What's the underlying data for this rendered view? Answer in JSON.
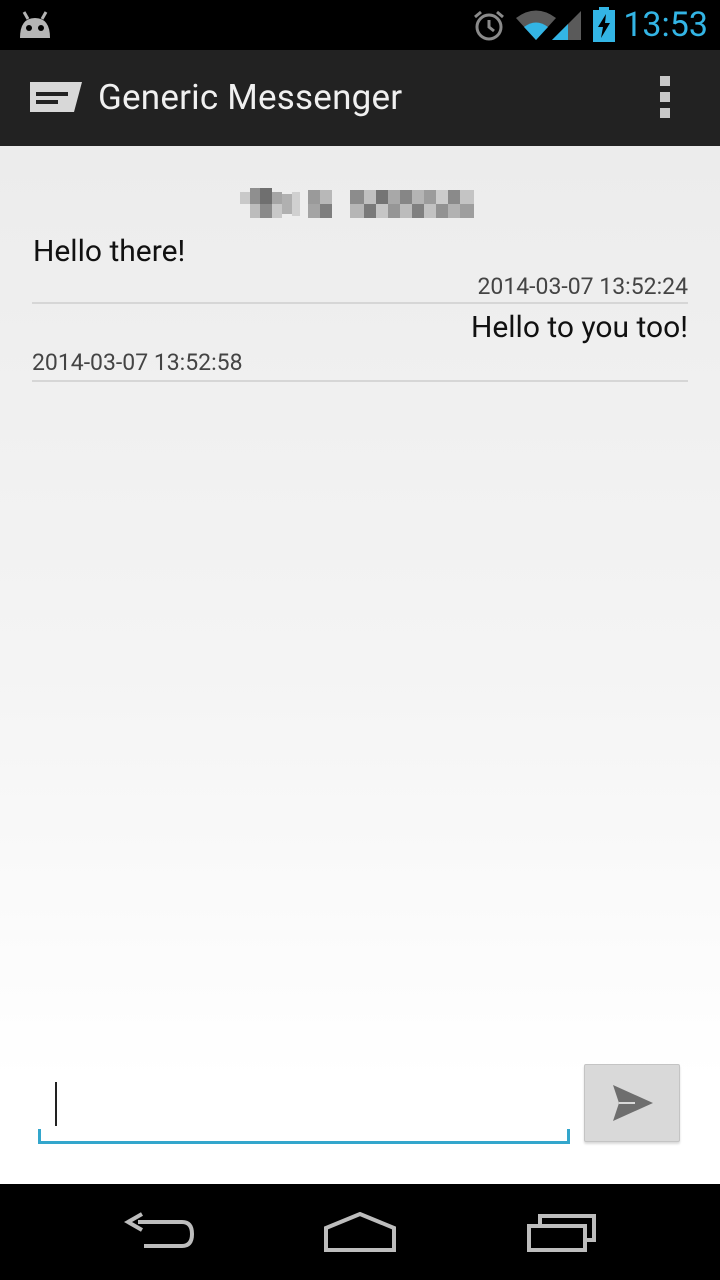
{
  "status_bar": {
    "time": "13:53",
    "icons": [
      "android-icon",
      "alarm-icon",
      "wifi-icon",
      "signal-icon",
      "battery-charging-icon"
    ],
    "accent_color": "#33b5e5"
  },
  "action_bar": {
    "title": "Generic Messenger",
    "icons": [
      "message-app-icon",
      "overflow-menu-icon"
    ]
  },
  "conversation": {
    "contact_name_pixelated": true,
    "messages": [
      {
        "text": "Hello there!",
        "timestamp": "2014-03-07 13:52:24",
        "direction": "incoming"
      },
      {
        "text": "Hello to you too!",
        "timestamp": "2014-03-07 13:52:58",
        "direction": "outgoing"
      }
    ]
  },
  "compose": {
    "value": "",
    "placeholder": "",
    "send_icon": "send-icon",
    "accent_color": "#33a6cc"
  },
  "nav_bar": {
    "icons": [
      "back-icon",
      "home-icon",
      "recents-icon"
    ]
  }
}
